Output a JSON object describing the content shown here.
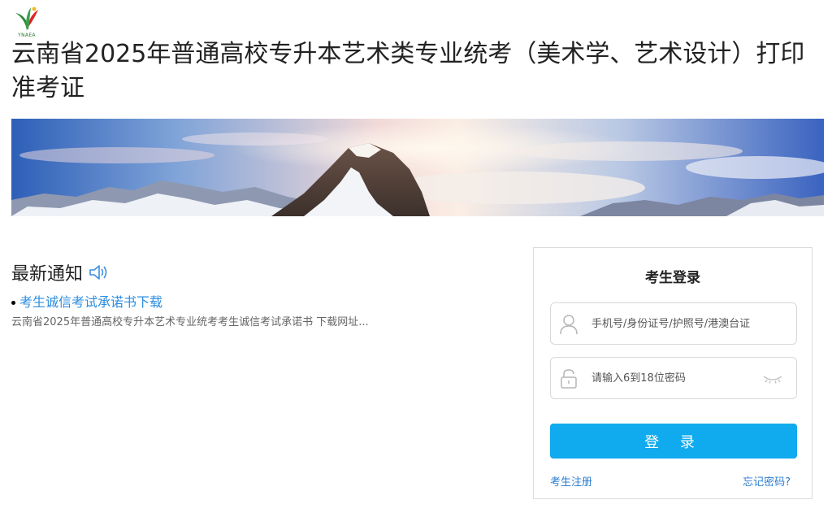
{
  "logo": {
    "text": "YNAEA",
    "icon": "ynaea-logo-icon"
  },
  "page_title": "云南省2025年普通高校专升本艺术类专业统考（美术学、艺术设计）打印准考证",
  "banner": {
    "icon": "mountain-banner-image"
  },
  "notice": {
    "heading": "最新通知",
    "heading_icon": "speaker-icon",
    "items": [
      {
        "title": "考生诚信考试承诺书下载",
        "summary": "云南省2025年普通高校专升本艺术专业统考考生诚信考试承诺书 下载网址..."
      }
    ]
  },
  "login": {
    "title": "考生登录",
    "username_placeholder": "手机号/身份证号/护照号/港澳台证",
    "password_placeholder": "请输入6到18位密码",
    "submit_label": "登 录",
    "register_label": "考生注册",
    "forgot_label": "忘记密码?",
    "colors": {
      "button": "#10aaee",
      "link": "#2b7dd0"
    }
  }
}
